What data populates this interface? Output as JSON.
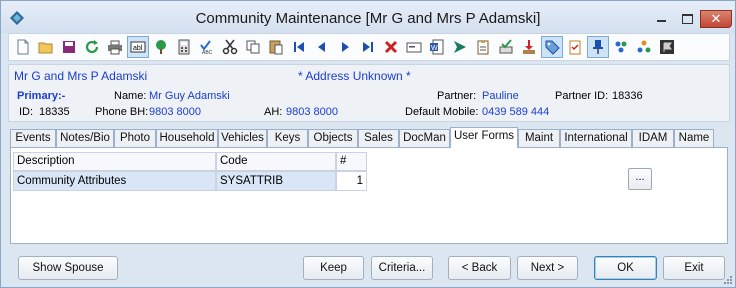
{
  "window": {
    "title": "Community Maintenance  [Mr G and Mrs P Adamski]",
    "close_glyph": "✕"
  },
  "toolbar": {
    "icons": [
      "new-doc-icon",
      "open-folder-icon",
      "save-icon",
      "refresh-icon",
      "print-icon",
      "textbox-icon",
      "tree-icon",
      "calculator-icon",
      "spellcheck-icon",
      "cut-icon",
      "copy-icon",
      "paste-icon",
      "first-record-icon",
      "previous-record-icon",
      "next-record-icon",
      "last-record-icon",
      "delete-icon",
      "card-icon",
      "word-doc-icon",
      "send-icon",
      "clipboard-edit-icon",
      "approve-icon",
      "download-icon",
      "tag-icon",
      "checklist-icon",
      "pin-icon",
      "people-icon",
      "group-icon",
      "flag-icon"
    ],
    "active": [
      "textbox-icon",
      "tag-icon",
      "pin-icon"
    ]
  },
  "header": {
    "name": "Mr G and Mrs P Adamski",
    "address_warning": "* Address Unknown *",
    "primary_label": "Primary:-",
    "name_label": "Name:",
    "name_value": "Mr Guy Adamski",
    "partner_label": "Partner:",
    "partner_value": "Pauline",
    "partner_id_label": "Partner ID:",
    "partner_id_value": "18336",
    "id_label": "ID:",
    "id_value": "18335",
    "phone_bh_label": "Phone BH:",
    "phone_bh_value": "9803 8000",
    "ah_label": "AH:",
    "ah_value": "9803 8000",
    "mobile_label": "Default Mobile:",
    "mobile_value": "0439 589 444"
  },
  "tabs": [
    {
      "label": "Events"
    },
    {
      "label": "Notes/Bio"
    },
    {
      "label": "Photo"
    },
    {
      "label": "Household"
    },
    {
      "label": "Vehicles"
    },
    {
      "label": "Keys"
    },
    {
      "label": "Objects"
    },
    {
      "label": "Sales"
    },
    {
      "label": "DocMan"
    },
    {
      "label": "User Forms"
    },
    {
      "label": "Maint"
    },
    {
      "label": "International"
    },
    {
      "label": "IDAM"
    },
    {
      "label": "Name"
    }
  ],
  "selected_tab": "User Forms",
  "grid": {
    "columns": [
      "Description",
      "Code",
      "#"
    ],
    "rows": [
      {
        "description": "Community Attributes",
        "code": "SYSATTRIB",
        "count": "1"
      }
    ]
  },
  "ellipsis_label": "...",
  "buttons": {
    "show_spouse": "Show Spouse",
    "keep": "Keep",
    "criteria": "Criteria...",
    "back": "< Back",
    "next": "Next >",
    "ok": "OK",
    "exit": "Exit"
  }
}
